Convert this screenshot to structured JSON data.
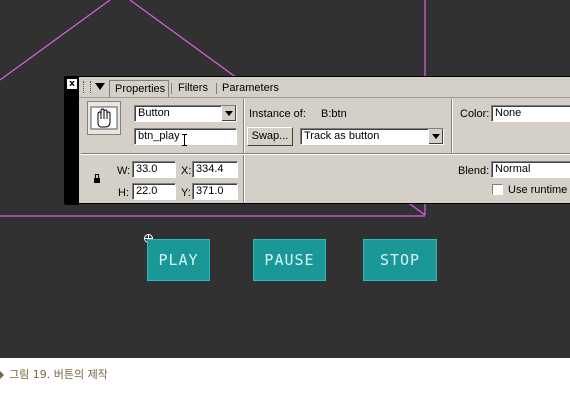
{
  "panel": {
    "close_glyph": "x",
    "tabs": [
      "Properties",
      "Filters",
      "Parameters"
    ],
    "symbol_type": "Button",
    "instance_name": "btn_play",
    "instance_of_label": "Instance of:",
    "instance_of_value": "B:btn",
    "swap_label": "Swap...",
    "track_value": "Track as button",
    "color_label": "Color:",
    "color_value": "None",
    "w_label": "W:",
    "w_value": "33.0",
    "x_label": "X:",
    "x_value": "334.4",
    "h_label": "H:",
    "h_value": "22.0",
    "y_label": "Y:",
    "y_value": "371.0",
    "blend_label": "Blend:",
    "blend_value": "Normal",
    "runtime_label": "Use runtime b"
  },
  "stage": {
    "buttons": [
      "PLAY",
      "PAUSE",
      "STOP"
    ],
    "guide_color": "#e060e0",
    "button_color": "#1a9898"
  },
  "caption": "그림 19. 버튼의 제작"
}
